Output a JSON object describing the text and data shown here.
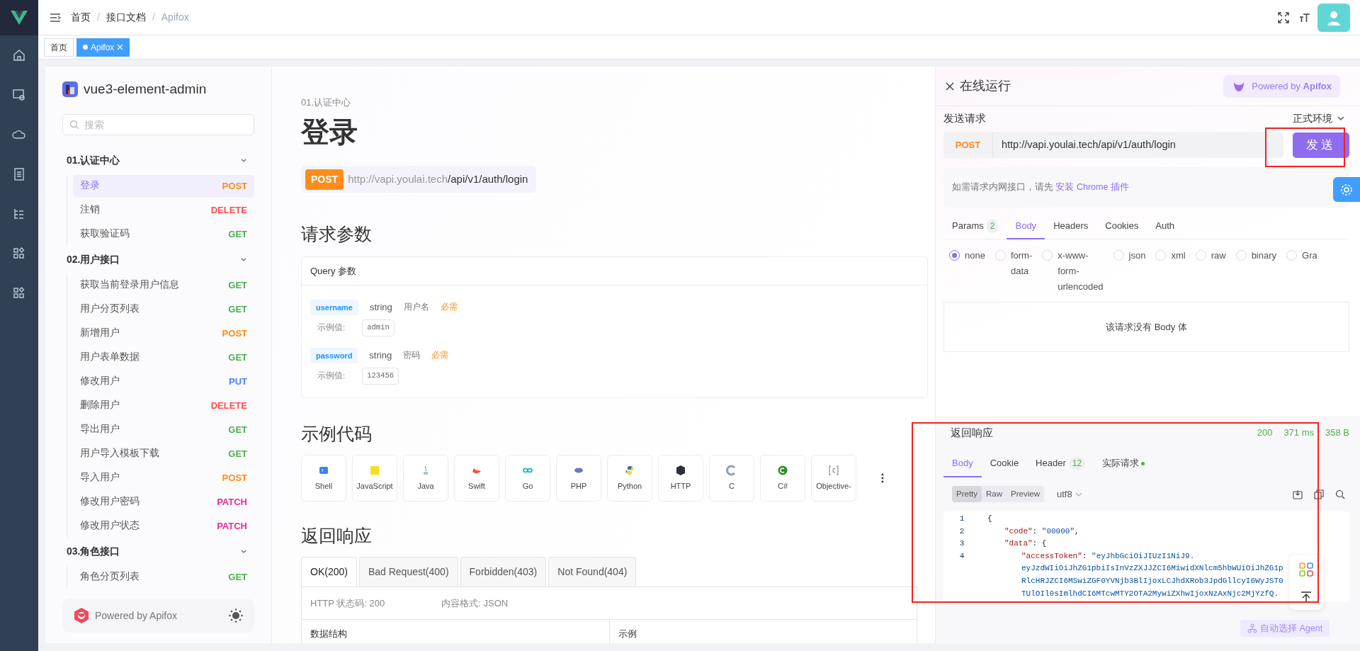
{
  "breadcrumb": [
    {
      "label": "首页",
      "separator": "/",
      "current": false
    },
    {
      "label": "接口文档",
      "separator": "/",
      "current": false
    },
    {
      "label": "Apifox",
      "current": true
    }
  ],
  "tags": [
    {
      "label": "首页",
      "selected": false,
      "closable": false
    },
    {
      "label": "Apifox",
      "selected": true,
      "closable": true
    }
  ],
  "project": {
    "name": "vue3-element-admin"
  },
  "search": {
    "placeholder": "搜索"
  },
  "groups": [
    {
      "title": "01.认证中心",
      "expanded": true,
      "items": [
        {
          "label": "登录",
          "method": "POST",
          "color": "#ff8c1a",
          "selected": true
        },
        {
          "label": "注销",
          "method": "DELETE",
          "color": "#ff4d4f",
          "selected": false
        },
        {
          "label": "获取验证码",
          "method": "GET",
          "color": "#4caf50",
          "selected": false
        }
      ]
    },
    {
      "title": "02.用户接口",
      "expanded": true,
      "items": [
        {
          "label": "获取当前登录用户信息",
          "method": "GET",
          "color": "#4caf50",
          "selected": false
        },
        {
          "label": "用户分页列表",
          "method": "GET",
          "color": "#4caf50",
          "selected": false
        },
        {
          "label": "新增用户",
          "method": "POST",
          "color": "#ff8c1a",
          "selected": false
        },
        {
          "label": "用户表单数据",
          "method": "GET",
          "color": "#4caf50",
          "selected": false
        },
        {
          "label": "修改用户",
          "method": "PUT",
          "color": "#4d7cfe",
          "selected": false
        },
        {
          "label": "删除用户",
          "method": "DELETE",
          "color": "#ff4d4f",
          "selected": false
        },
        {
          "label": "导出用户",
          "method": "GET",
          "color": "#4caf50",
          "selected": false
        },
        {
          "label": "用户导入模板下载",
          "method": "GET",
          "color": "#4caf50",
          "selected": false
        },
        {
          "label": "导入用户",
          "method": "POST",
          "color": "#ff8c1a",
          "selected": false
        },
        {
          "label": "修改用户密码",
          "method": "PATCH",
          "color": "#eb2f96",
          "selected": false
        },
        {
          "label": "修改用户状态",
          "method": "PATCH",
          "color": "#eb2f96",
          "selected": false
        }
      ]
    },
    {
      "title": "03.角色接口",
      "expanded": true,
      "items": [
        {
          "label": "角色分页列表",
          "method": "GET",
          "color": "#4caf50",
          "selected": false
        }
      ]
    }
  ],
  "sidebar_footer": {
    "text": "Powered by Apifox"
  },
  "doc": {
    "category": "01.认证中心",
    "title": "登录",
    "method": "POST",
    "url_host": "http://vapi.youlai.tech",
    "url_path": "/api/v1/auth/login",
    "params_heading": "请求参数",
    "query_title": "Query 参数",
    "params": [
      {
        "name": "username",
        "type": "string",
        "description": "用户名",
        "required": "必需",
        "example_label": "示例值:",
        "example": "admin"
      },
      {
        "name": "password",
        "type": "string",
        "description": "密码",
        "required": "必需",
        "example_label": "示例值:",
        "example": "123456"
      }
    ],
    "code_heading": "示例代码",
    "languages": [
      {
        "label": "Shell",
        "kind": "shell"
      },
      {
        "label": "JavaScript",
        "kind": "javascript"
      },
      {
        "label": "Java",
        "kind": "java"
      },
      {
        "label": "Swift",
        "kind": "swift"
      },
      {
        "label": "Go",
        "kind": "go"
      },
      {
        "label": "PHP",
        "kind": "php"
      },
      {
        "label": "Python",
        "kind": "python"
      },
      {
        "label": "HTTP",
        "kind": "http"
      },
      {
        "label": "C",
        "kind": "c"
      },
      {
        "label": "C#",
        "kind": "csharp"
      },
      {
        "label": "Objective-",
        "kind": "objc"
      }
    ],
    "response_heading": "返回响应",
    "response_tabs": [
      {
        "label": "OK(200)",
        "selected": true
      },
      {
        "label": "Bad Request(400)",
        "selected": false
      },
      {
        "label": "Forbidden(403)",
        "selected": false
      },
      {
        "label": "Not Found(404)",
        "selected": false
      }
    ],
    "status_line": "HTTP 状态码: 200",
    "format_line": "内容格式: JSON",
    "table_columns": [
      "数据结构",
      "示例"
    ]
  },
  "runner": {
    "title": "在线运行",
    "powered": "Powered by **Apifox**",
    "send_heading": "发送请求",
    "environment": "正式环境",
    "method": "POST",
    "url": "http://vapi.youlai.tech/api/v1/auth/login",
    "send_button": "发送",
    "hint": "如需请求内网接口，请先",
    "hint_link": "安装 Chrome 插件",
    "tabs": [
      {
        "label": "Params",
        "count": "2",
        "selected": false
      },
      {
        "label": "Body",
        "selected": true
      },
      {
        "label": "Headers",
        "selected": false
      },
      {
        "label": "Cookies",
        "selected": false
      },
      {
        "label": "Auth",
        "selected": false
      }
    ],
    "body_types": [
      {
        "label": "none",
        "selected": true
      },
      {
        "label": "form-data",
        "selected": false
      },
      {
        "label": "x-www-form-urlencoded",
        "selected": false
      },
      {
        "label": "json",
        "selected": false
      },
      {
        "label": "xml",
        "selected": false
      },
      {
        "label": "raw",
        "selected": false
      },
      {
        "label": "binary",
        "selected": false
      },
      {
        "label": "Gra",
        "selected": false
      }
    ],
    "empty_body": "该请求没有 Body 体"
  },
  "response": {
    "title": "返回响应",
    "status": "200",
    "time": "371 ms",
    "size": "358 B",
    "tabs": [
      {
        "label": "Body",
        "selected": true,
        "dot": false
      },
      {
        "label": "Cookie",
        "selected": false,
        "dot": false
      },
      {
        "label": "Header",
        "count": "12",
        "selected": false,
        "dot": false
      },
      {
        "label": "实际请求",
        "selected": false,
        "dot": true
      }
    ],
    "views": [
      {
        "label": "Pretty",
        "selected": true
      },
      {
        "label": "Raw",
        "selected": false
      },
      {
        "label": "Preview",
        "selected": false
      }
    ],
    "encoding": "utf8",
    "code": [
      {
        "number": "1",
        "tokens": [
          {
            "kind": "punct",
            "text": "{"
          }
        ],
        "children": [
          {
            "number": "2",
            "tokens": [
              {
                "kind": "key",
                "text": "\"code\""
              },
              {
                "kind": "punct",
                "text": ": "
              },
              {
                "kind": "string",
                "text": "\"00000\""
              },
              {
                "kind": "punct",
                "text": ","
              }
            ]
          },
          {
            "number": "3",
            "tokens": [
              {
                "kind": "key",
                "text": "\"data\""
              },
              {
                "kind": "punct",
                "text": ": {"
              }
            ],
            "children": [
              {
                "number": "4",
                "tokens": [
                  {
                    "kind": "key",
                    "text": "\"accessToken\""
                  },
                  {
                    "kind": "punct",
                    "text": ": "
                  },
                  {
                    "kind": "string",
                    "text": "\"eyJhbGciOiJIUzI1NiJ9."
                  }
                ],
                "wrap_lines": [
                  "eyJzdWIiOiJhZG1pbiIsInVzZXJJZCI6MiwidXNlcm5hbWUiOiJhZG1p",
                  "RlcHRJZCI6MSwiZGF0YVNjb3BlIjoxLCJhdXRob3JpdGllcyI6WyJST0",
                  "TUlOIl0sImlhdCI6MTcwMTY2OTA2MywiZXhwIjoxNzAxNjc2MjYzfQ."
                ]
              }
            ]
          }
        ]
      }
    ],
    "agent_button": "自动选择 Agent"
  }
}
